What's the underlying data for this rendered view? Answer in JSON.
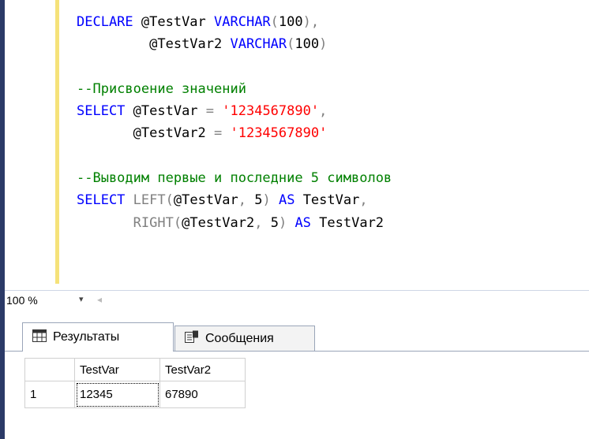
{
  "editor": {
    "lines": [
      [
        {
          "t": "DECLARE ",
          "c": "kw"
        },
        {
          "t": "@TestVar ",
          "c": ""
        },
        {
          "t": "VARCHAR",
          "c": "kw"
        },
        {
          "t": "(",
          "c": "op"
        },
        {
          "t": "100",
          "c": ""
        },
        {
          "t": "),",
          "c": "op"
        }
      ],
      [
        {
          "t": "         @TestVar2 ",
          "c": ""
        },
        {
          "t": "VARCHAR",
          "c": "kw"
        },
        {
          "t": "(",
          "c": "op"
        },
        {
          "t": "100",
          "c": ""
        },
        {
          "t": ")",
          "c": "op"
        }
      ],
      [],
      [
        {
          "t": "--Присвоение значений",
          "c": "cm"
        }
      ],
      [
        {
          "t": "SELECT ",
          "c": "kw"
        },
        {
          "t": "@TestVar ",
          "c": ""
        },
        {
          "t": "= ",
          "c": "op"
        },
        {
          "t": "'1234567890'",
          "c": "str"
        },
        {
          "t": ",",
          "c": "op"
        }
      ],
      [
        {
          "t": "       @TestVar2 ",
          "c": ""
        },
        {
          "t": "= ",
          "c": "op"
        },
        {
          "t": "'1234567890'",
          "c": "str"
        }
      ],
      [],
      [
        {
          "t": "--Выводим первые и последние 5 символов",
          "c": "cm"
        }
      ],
      [
        {
          "t": "SELECT ",
          "c": "kw"
        },
        {
          "t": "LEFT",
          "c": "fn"
        },
        {
          "t": "(",
          "c": "op"
        },
        {
          "t": "@TestVar",
          "c": ""
        },
        {
          "t": ", ",
          "c": "op"
        },
        {
          "t": "5",
          "c": ""
        },
        {
          "t": ") ",
          "c": "op"
        },
        {
          "t": "AS ",
          "c": "kw"
        },
        {
          "t": "TestVar",
          "c": ""
        },
        {
          "t": ",",
          "c": "op"
        }
      ],
      [
        {
          "t": "       ",
          "c": ""
        },
        {
          "t": "RIGHT",
          "c": "fn"
        },
        {
          "t": "(",
          "c": "op"
        },
        {
          "t": "@TestVar2",
          "c": ""
        },
        {
          "t": ", ",
          "c": "op"
        },
        {
          "t": "5",
          "c": ""
        },
        {
          "t": ") ",
          "c": "op"
        },
        {
          "t": "AS ",
          "c": "kw"
        },
        {
          "t": "TestVar2",
          "c": ""
        }
      ]
    ]
  },
  "zoom": {
    "value": "100 %",
    "arrow": "▾",
    "scroll_left": "◂"
  },
  "tabs": {
    "results_label": "Результаты",
    "results_icon": "grid-icon",
    "messages_label": "Сообщения",
    "messages_icon": "messages-icon"
  },
  "grid": {
    "headers": [
      "TestVar",
      "TestVar2"
    ],
    "rows": [
      {
        "num": "1",
        "cells": [
          "12345",
          "67890"
        ]
      }
    ]
  }
}
